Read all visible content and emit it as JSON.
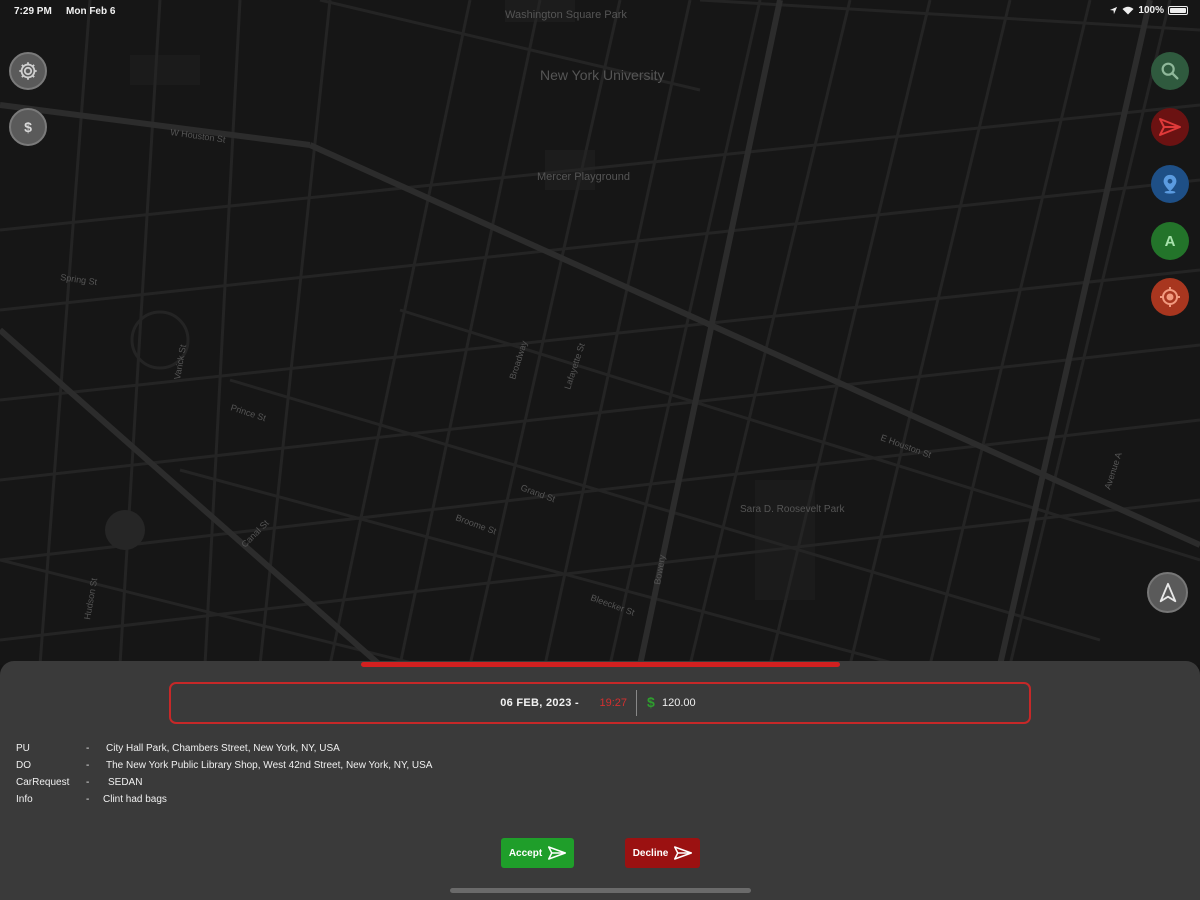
{
  "status_bar": {
    "time": "7:29 PM",
    "date": "Mon Feb 6",
    "battery": "100%"
  },
  "map": {
    "labels": [
      {
        "text": "Washington Square Park",
        "size": "large"
      },
      {
        "text": "New York University",
        "size": "large"
      },
      {
        "text": "Mercer Playground",
        "size": "medium"
      },
      {
        "text": "Sara D. Roosevelt Park",
        "size": "medium"
      },
      {
        "text": "W Houston St",
        "size": "small"
      },
      {
        "text": "E Houston St",
        "size": "small"
      },
      {
        "text": "Spring St",
        "size": "small"
      },
      {
        "text": "Broome St",
        "size": "small"
      },
      {
        "text": "Grand St",
        "size": "small"
      },
      {
        "text": "Canal St",
        "size": "small"
      },
      {
        "text": "Broadway",
        "size": "small"
      },
      {
        "text": "Lafayette St",
        "size": "small"
      },
      {
        "text": "Bowery",
        "size": "small"
      },
      {
        "text": "Avenue A",
        "size": "small"
      },
      {
        "text": "Bleecker St",
        "size": "small"
      },
      {
        "text": "Hudson St",
        "size": "small"
      },
      {
        "text": "Varick St",
        "size": "small"
      },
      {
        "text": "Prince St",
        "size": "small"
      }
    ]
  },
  "map_controls": {
    "left": [
      {
        "name": "settings",
        "icon": "gear-icon"
      },
      {
        "name": "earnings",
        "icon": "dollar-icon"
      }
    ],
    "right": [
      {
        "name": "search",
        "icon": "search-icon",
        "color": "#2f5a3e"
      },
      {
        "name": "navigate",
        "icon": "send-arrow-icon",
        "color": "#6b1212"
      },
      {
        "name": "pin",
        "icon": "map-pin-icon",
        "color": "#1e4f86"
      },
      {
        "name": "profile",
        "icon": "letter-a-icon",
        "color": "#23742a",
        "glyph": "A"
      },
      {
        "name": "locate",
        "icon": "target-icon",
        "color": "#a8361f"
      }
    ],
    "compass": {
      "icon": "compass-arrow-icon"
    }
  },
  "ride_request": {
    "date": "06 FEB, 2023 -",
    "time": "19:27",
    "currency": "$",
    "amount": "120.00",
    "details": [
      {
        "label": "PU",
        "sep": "-",
        "value": "City Hall Park, Chambers Street, New York, NY, USA"
      },
      {
        "label": "DO",
        "sep": "-",
        "value": "The New York Public Library Shop, West 42nd Street, New York, NY, USA"
      },
      {
        "label": "CarRequest",
        "sep": "-",
        "value": "SEDAN"
      },
      {
        "label": "Info",
        "sep": "-",
        "value": "Clint had bags"
      }
    ],
    "accept_label": "Accept",
    "decline_label": "Decline",
    "colors": {
      "accent": "#d22020",
      "accept": "#1f9e2a",
      "decline": "#9b1111",
      "money": "#2e9e2e"
    }
  }
}
